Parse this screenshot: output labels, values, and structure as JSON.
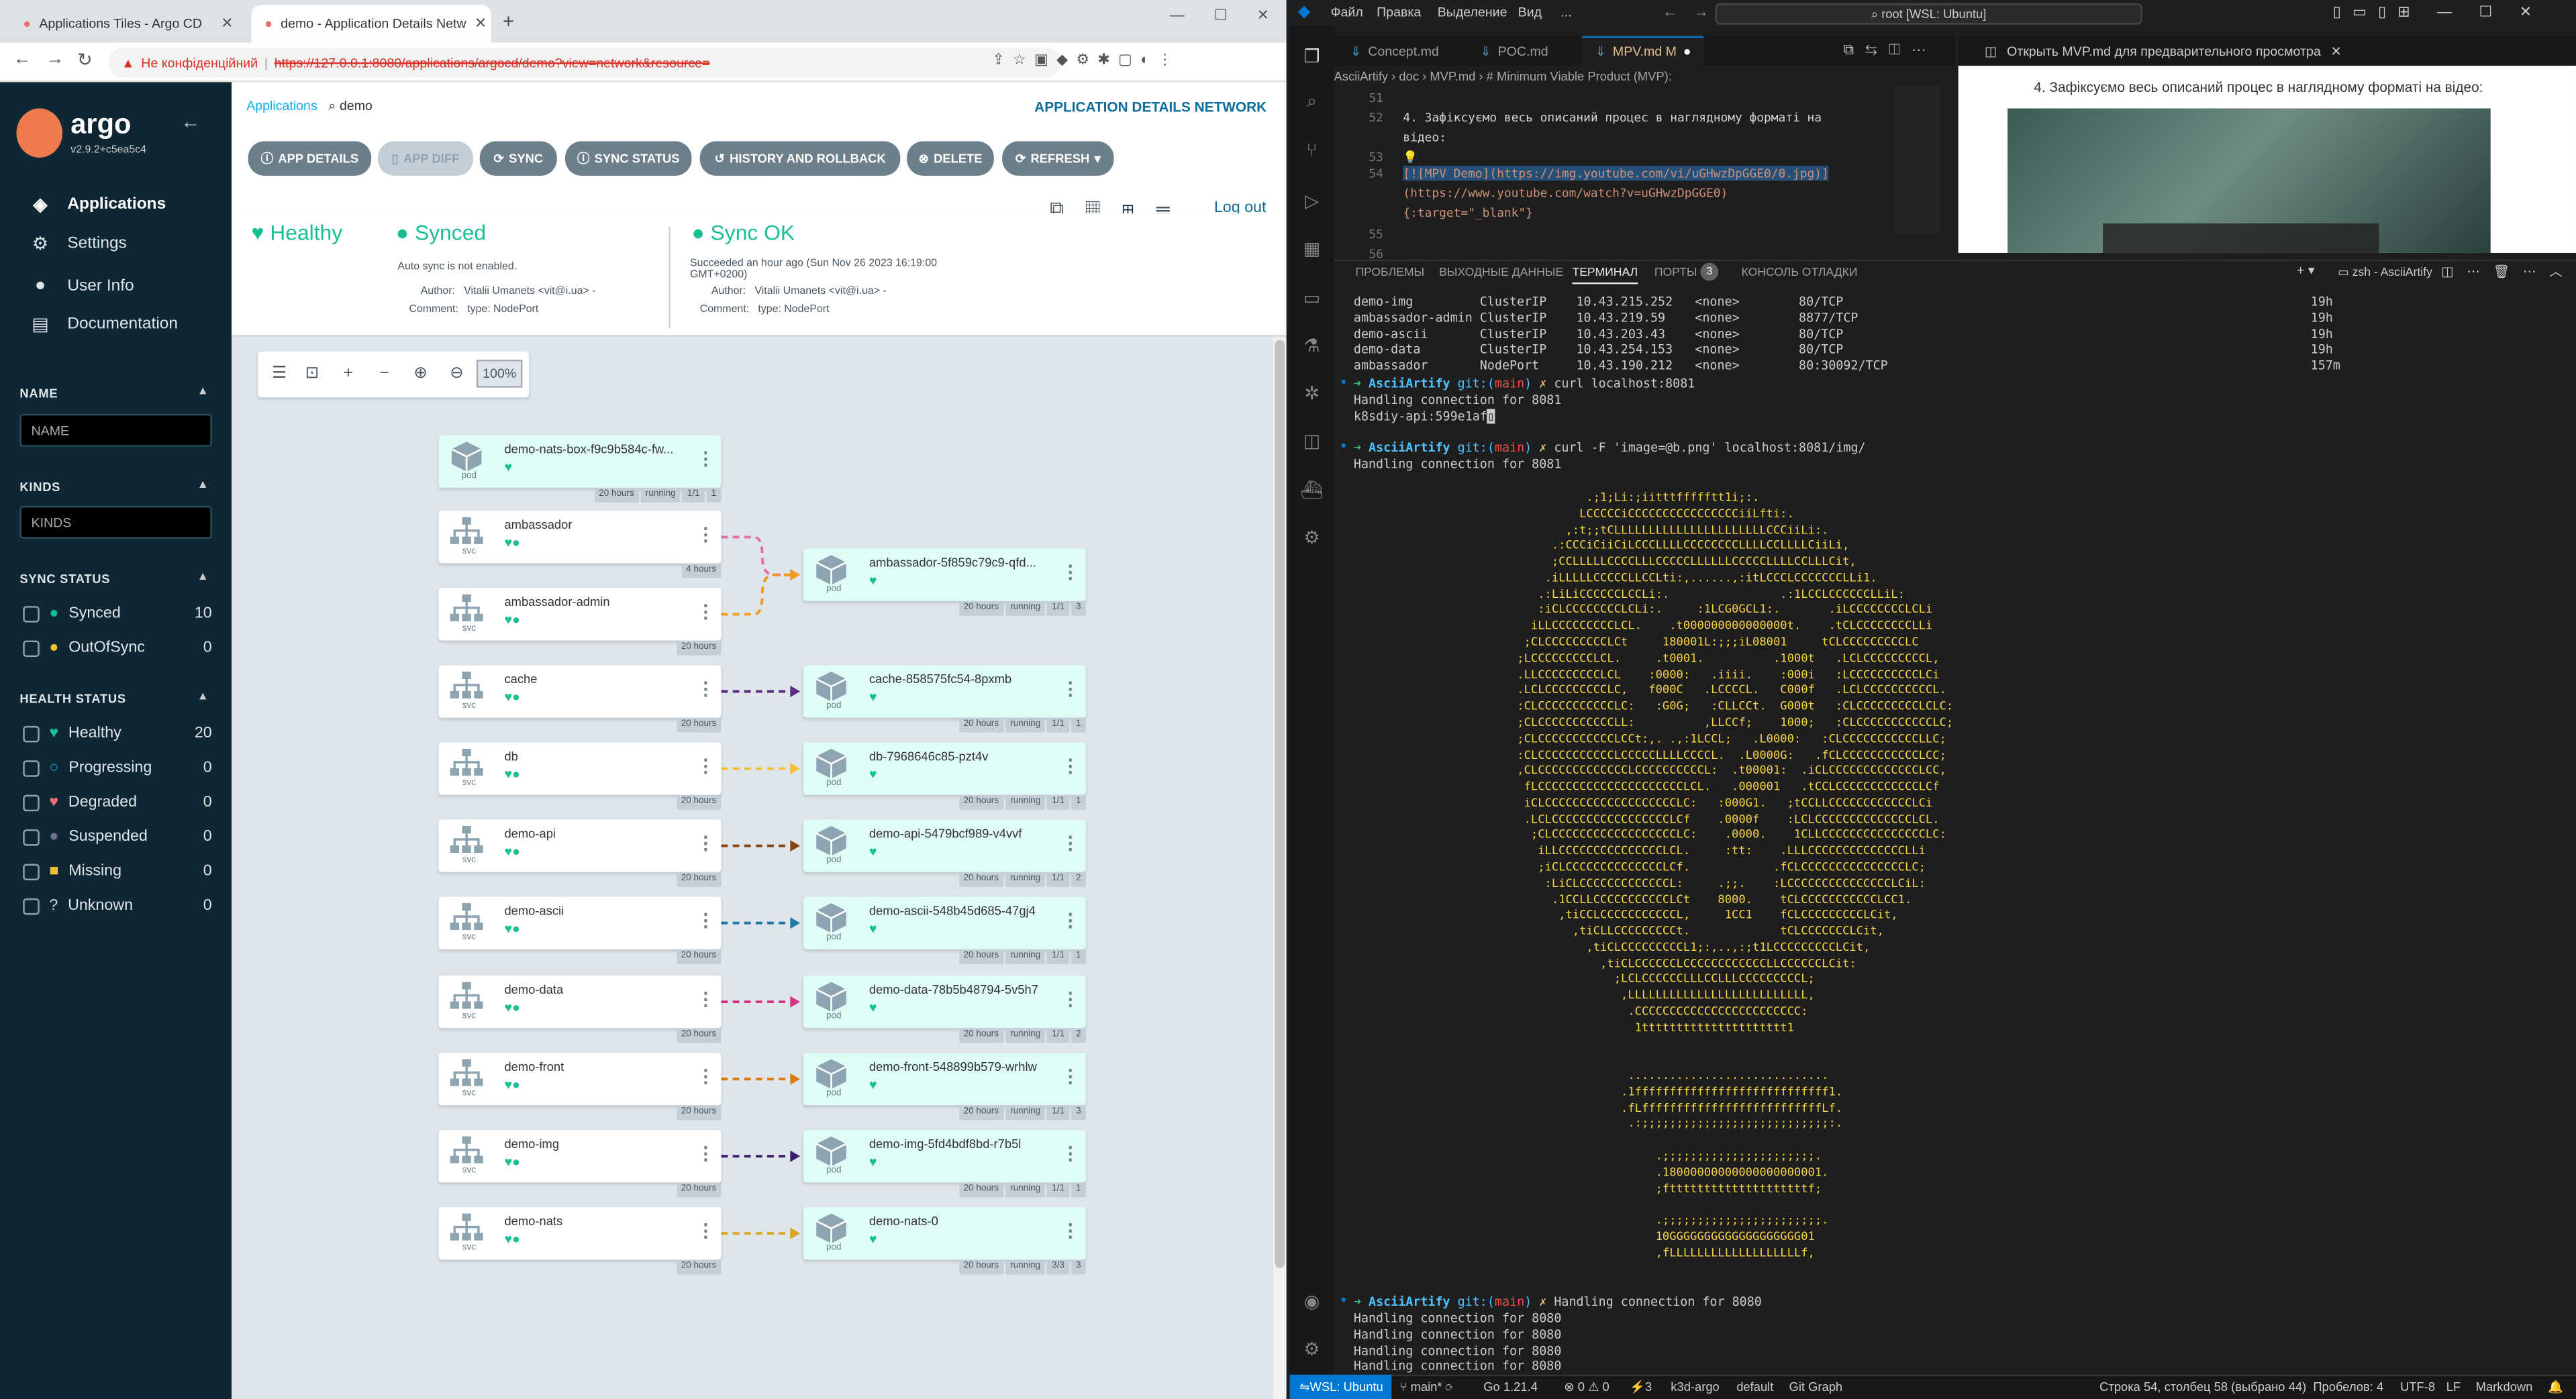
{
  "browser": {
    "tabs": [
      {
        "title": "Applications Tiles - Argo CD"
      },
      {
        "title": "demo - Application Details Netw"
      }
    ],
    "address": {
      "warning": "Не конфіденційний",
      "url": "https://127.0.0.1:8080/applications/argocd/demo?view=network&resource="
    }
  },
  "argo": {
    "logo_text": "argo",
    "version": "v2.9.2+c5ea5c4",
    "nav": [
      {
        "label": "Applications",
        "icon": "layers-icon"
      },
      {
        "label": "Settings",
        "icon": "gear-icon"
      },
      {
        "label": "User Info",
        "icon": "user-icon"
      },
      {
        "label": "Documentation",
        "icon": "book-icon"
      }
    ],
    "filters": {
      "name_header": "NAME",
      "name_placeholder": "NAME",
      "kinds_header": "KINDS",
      "kinds_placeholder": "KINDS",
      "sync_header": "SYNC STATUS",
      "sync": [
        {
          "label": "Synced",
          "count": "10",
          "color": "#18be94"
        },
        {
          "label": "OutOfSync",
          "count": "0",
          "color": "#f4c030"
        }
      ],
      "health_header": "HEALTH STATUS",
      "health": [
        {
          "label": "Healthy",
          "count": "20",
          "color": "#18be94"
        },
        {
          "label": "Progressing",
          "count": "0",
          "color": "#0dadea"
        },
        {
          "label": "Degraded",
          "count": "0",
          "color": "#e96d76"
        },
        {
          "label": "Suspended",
          "count": "0",
          "color": "#766f94"
        },
        {
          "label": "Missing",
          "count": "0",
          "color": "#f4c030"
        },
        {
          "label": "Unknown",
          "count": "0",
          "color": "#ccd6dd"
        }
      ]
    },
    "breadcrumb": {
      "root": "Applications",
      "current": "demo"
    },
    "page_title": "APPLICATION DETAILS NETWORK",
    "actions": [
      "APP DETAILS",
      "APP DIFF",
      "SYNC",
      "SYNC STATUS",
      "HISTORY AND ROLLBACK",
      "DELETE",
      "REFRESH"
    ],
    "logout": "Log out",
    "summary": {
      "health": "Healthy",
      "sync": "Synced",
      "sync_note": "Auto sync is not enabled.",
      "author_label": "Author:",
      "author": "Vitalii Umanets <vit@i.ua> -",
      "comment_label": "Comment:",
      "comment": "type: NodePort",
      "op": "Sync OK",
      "op_time": "Succeeded an hour ago (Sun Nov 26 2023 16:19:00 GMT+0200)"
    },
    "zoom": "100%",
    "nodes": [
      {
        "name": "demo-nats-box-f9c9b584c-fw...",
        "kind": "pod",
        "tags": [
          "20 hours",
          "running",
          "1/1",
          "1"
        ]
      },
      {
        "name": "ambassador",
        "kind": "svc",
        "tags": [
          "4 hours"
        ]
      },
      {
        "name": "ambassador-admin",
        "kind": "svc",
        "tags": [
          "20 hours"
        ]
      },
      {
        "name": "cache",
        "kind": "svc",
        "tags": [
          "20 hours"
        ]
      },
      {
        "name": "db",
        "kind": "svc",
        "tags": [
          "20 hours"
        ]
      },
      {
        "name": "demo-api",
        "kind": "svc",
        "tags": [
          "20 hours"
        ]
      },
      {
        "name": "demo-ascii",
        "kind": "svc",
        "tags": [
          "20 hours"
        ]
      },
      {
        "name": "demo-data",
        "kind": "svc",
        "tags": [
          "20 hours"
        ]
      },
      {
        "name": "demo-front",
        "kind": "svc",
        "tags": [
          "20 hours"
        ]
      },
      {
        "name": "demo-img",
        "kind": "svc",
        "tags": [
          "20 hours"
        ]
      },
      {
        "name": "demo-nats",
        "kind": "svc",
        "tags": [
          "20 hours"
        ]
      },
      {
        "name": "ambassador-5f859c79c9-qfd...",
        "kind": "pod",
        "tags": [
          "20 hours",
          "running",
          "1/1",
          "3"
        ]
      },
      {
        "name": "cache-858575fc54-8pxmb",
        "kind": "pod",
        "tags": [
          "20 hours",
          "running",
          "1/1",
          "1"
        ]
      },
      {
        "name": "db-7968646c85-pzt4v",
        "kind": "pod",
        "tags": [
          "20 hours",
          "running",
          "1/1",
          "1"
        ]
      },
      {
        "name": "demo-api-5479bcf989-v4vvf",
        "kind": "pod",
        "tags": [
          "20 hours",
          "running",
          "1/1",
          "2"
        ]
      },
      {
        "name": "demo-ascii-548b45d685-47gj4",
        "kind": "pod",
        "tags": [
          "20 hours",
          "running",
          "1/1",
          "1"
        ]
      },
      {
        "name": "demo-data-78b5b48794-5v5h7",
        "kind": "pod",
        "tags": [
          "20 hours",
          "running",
          "1/1",
          "2"
        ]
      },
      {
        "name": "demo-front-548899b579-wrhlw",
        "kind": "pod",
        "tags": [
          "20 hours",
          "running",
          "1/1",
          "3"
        ]
      },
      {
        "name": "demo-img-5fd4bdf8bd-r7b5l",
        "kind": "pod",
        "tags": [
          "20 hours",
          "running",
          "1/1",
          "1"
        ]
      },
      {
        "name": "demo-nats-0",
        "kind": "pod",
        "tags": [
          "20 hours",
          "running",
          "3/3",
          "3"
        ]
      }
    ],
    "edge_colors": [
      "#e96dab",
      "#f19a1c",
      "#5a2a82",
      "#f4c030",
      "#8b4513",
      "#1f7aa8",
      "#d63384",
      "#d97b0d",
      "#3b1e6b",
      "#d9a51b"
    ]
  },
  "vscode": {
    "menu": [
      "Файл",
      "Правка",
      "Выделение",
      "Вид",
      "..."
    ],
    "search": "root [WSL: Ubuntu]",
    "editor_tabs": [
      "Concept.md",
      "POC.md",
      "MPV.md M"
    ],
    "breadcrumb": "AsciiArtify › doc › MVP.md › # Minimum Viable Product (MVP):",
    "code": [
      {
        "n": "51",
        "t": ""
      },
      {
        "n": "52",
        "t": "4. Зафіксуємо весь описаний процес в наглядному форматі на"
      },
      {
        "n": "",
        "t": "відео:"
      },
      {
        "n": "53",
        "t": "💡"
      },
      {
        "n": "54",
        "t": "[![MPV Demo](https://img.youtube.com/vi/uGHwzDpGGE0/0.jpg)]"
      },
      {
        "n": "",
        "t": "(https://www.youtube.com/watch?v=uGHwzDpGGE0)"
      },
      {
        "n": "",
        "t": "{:target=\"_blank\"}"
      },
      {
        "n": "55",
        "t": ""
      },
      {
        "n": "56",
        "t": ""
      }
    ],
    "preview_tab": "Открыть MVP.md для предварительного просмотра",
    "preview_text": "4. Зафіксуємо весь описаний процес в наглядному форматі на відео:",
    "panel_tabs": [
      "ПРОБЛЕМЫ",
      "ВЫХОДНЫЕ ДАННЫЕ",
      "ТЕРМИНАЛ",
      "ПОРТЫ",
      "КОНСОЛЬ ОТЛАДКИ"
    ],
    "ports_count": "3",
    "terminal_name": "zsh - AsciiArtify",
    "services": [
      {
        "name": "demo-img",
        "type": "ClusterIP",
        "ip": "10.43.215.252",
        "ext": "<none>",
        "port": "80/TCP",
        "age": "19h"
      },
      {
        "name": "ambassador-admin",
        "type": "ClusterIP",
        "ip": "10.43.219.59",
        "ext": "<none>",
        "port": "8877/TCP",
        "age": "19h"
      },
      {
        "name": "demo-ascii",
        "type": "ClusterIP",
        "ip": "10.43.203.43",
        "ext": "<none>",
        "port": "80/TCP",
        "age": "19h"
      },
      {
        "name": "demo-data",
        "type": "ClusterIP",
        "ip": "10.43.254.153",
        "ext": "<none>",
        "port": "80/TCP",
        "age": "19h"
      },
      {
        "name": "ambassador",
        "type": "NodePort",
        "ip": "10.43.190.212",
        "ext": "<none>",
        "port": "80:30092/TCP",
        "age": "157m"
      }
    ],
    "prompt_dir": "AsciiArtify",
    "prompt_git": "git:(main)",
    "cmd1": "curl localhost:8081",
    "out1": [
      "Handling connection for 8081",
      "k8sdiy-api:599e1af"
    ],
    "cmd2": "curl -F 'image=@b.png' localhost:8081/img/",
    "out2": "Handling connection for 8081",
    "ascii_art": "            .;1;Li:;iitttffffftt1i;:.\n           LCCCCCiCCCCCCCCCCCCCCCCiiLfti:.\n         ,:t;;tCLLLLLLLLLLLLLLLLLLLLLLCCCiiLi:.\n       .:CCCiCiiCiLCCCLLLLCCCCCCCCLLLLCCLLLLCiiLi,\n       ;CCLLLLLCCCCLLLCCCCCLLLLLLCCCCCLLLLCCLLLCit,\n      .iLLLLLCCCCCLLCCLti:,......,:itLCCCLCCCCCCCLLi1.\n     .:LiLiCCCCCCLCCLi:.                .:1LCCLCCCCCCLLiL:\n     :iCLCCCCCCCCLCLi:.     :1LCG0GCL1:.       .iLCCCCCCCCLCLi\n    iLLCCCCCCCCCLCL.    .t000000000000000t.    .tCLCCCCCCCCLLi\n   ;CLCCCCCCCCCLCt     180001L:;;;iL08001     tCLCCCCCCCCCLC\n  ;LCCCCCCCCCLCL.     .t0001.          .1000t   .LCLCCCCCCCCCL,\n  .LLCCCCCCCCCLCL    :0000:   .iiii.    :000i   :LCCCCCCCCCCLCi\n  .LCLCCCCCCCCCLC,   f000C   .LCCCCL.   C000f   .LCLCCCCCCCCCCL.\n  :CLCCCCCCCCCCCLC:   :G0G;   :CLLCCt.  G000t   :CLCCCCCCCCCLCLC:\n  ;CLCCCCCCCCCCCLL:          ,LLCCf;    1000;   :CLCCCCCCCCCCCLC;\n  ;CLCCCCCCCCCCCLCCt:,. .,:1LCCL;   .L0000:   :CLCCCCCCCCCCCLLC;\n  :CLCCCCCCCCCCCLCCCCCLLLLCCCCL.  .L0000G:   .fCLCCCCCCCCCCCLCC;\n  ,CLCCCCCCCCCCCCCLCCCCCCCCCCL:  .t00001:  .iCLCCCCCCCCCCCCCLCC,\n   fLCCCCCCCCCCCCCCCCCCCCCLCL.   .000001   .tCCLCCCCCCCCCCCCLCf\n   iCLCCCCCCCCCCCCCCCCCCCLC:   :000G1.   ;tCCLLCCCCCCCCCCCCLCi\n   .LCLCCCCCCCCCCCCCCCCCLCf    .0000f    :LCLCCCCCCCCCCCCCCLCL.\n    ;CLCCCCCCCCCCCCCCCCCCLC:    .0000.    1CLLCCCCCCCCCCCCCCCLC:\n     iLLCCCCCCCCCCCCCCCLCL.     :tt:    .LLLCCCCCCCCCCCCCCLLi\n     ;iCLCCCCCCCCCCCCCCLCf.            .fCLCCCCCCCCCCCCCCCLC;\n      :LiCLCCCCCCCCCCCCCL:     .;;.    :LCCCCCCCCCCCCCCCLCiL:\n       .1CCLLCCCCCCCCCCCLCt    8000.    tCLCCCCCCCCCCCLCC1.\n        ,tiCCLCCCCCCCCCCCL,     1CC1    fCLCCCCCCCCCLCit,\n          ,tiCLLCCCCCCCCCt.             tCLCCCCCCCLCit,\n            ,tiCLCCCCCCCCCL1;:,..,:;t1LCCCCCCCCCLCit,\n              ,tiCLCCCCCCLCCCCCCCCCCCCLLCCCCCCLCit:\n                ;LCLCCCCCCLLLCCLLLCCCCCCCCCL;\n                 ,LLLLLLLLLLLLLLLLLLLLLLLLLL,\n                  .CCCCCCCCCCCCCCCCCCCCCCCC:\n                   1ttttttttttttttttttttt1\n\n\n                  .............................\n                 .1ffffffffffffffffffffffffffff1.\n                 .fLffffffffffffffffffffffffffLf.\n                  .:;;;;;;;;;;;;;;;;;;;;;;;;;;;:.\n\n                      .;;;;;;;;;;;;;;;;;;;;;;.\n                      .18000000000000000000001.\n                      ;fttttttttttttttttttttf;\n\n                      .;;;;;;;;;;;;;;;;;;;;;;;.\n                      10GGGGGGGGGGGGGGGGGGG01\n                      ,fLLLLLLLLLLLLLLLLLLLf,",
    "cmd3": "Handling connection for 8080",
    "out3": [
      "Handling connection for 8080",
      "Handling connection for 8080",
      "Handling connection for 8080",
      "Handling connection for 8080"
    ],
    "status": {
      "remote": "WSL: Ubuntu",
      "branch": "main*",
      "go": "Go 1.21.4",
      "errors": "⊗ 0  ⚠ 0",
      "ports": "⚡3",
      "ctx": "k3d-argo",
      "ns": "default",
      "git_graph": "Git Graph",
      "cursor": "Строка 54, столбец 58 (выбрано 44)",
      "spaces": "Пробелов: 4",
      "enc": "UTF-8",
      "eol": "LF",
      "lang": "Markdown"
    }
  }
}
